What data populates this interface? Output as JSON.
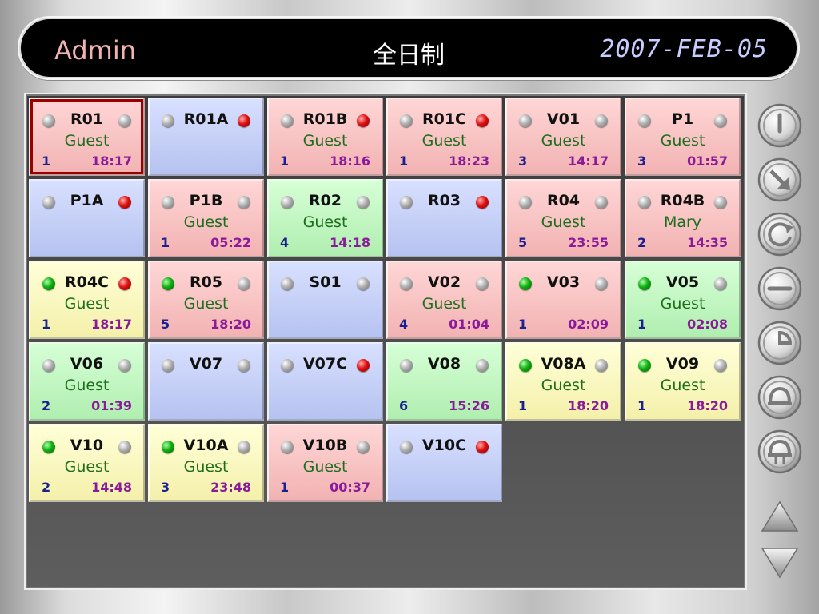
{
  "header": {
    "user": "Admin",
    "mode": "全日制",
    "date": "2007-FEB-05"
  },
  "colors": {
    "red": "#f2b2b2",
    "blue": "#b6c2f0",
    "green": "#b0eeb0",
    "yellow": "#f4f0aa"
  },
  "rooms": [
    {
      "name": "R01",
      "color": "red",
      "left": "gray",
      "right": "gray",
      "guest": "Guest",
      "count": "1",
      "time": "18:17",
      "selected": true
    },
    {
      "name": "R01A",
      "color": "blue",
      "left": "gray",
      "right": "red",
      "guest": "",
      "count": "",
      "time": ""
    },
    {
      "name": "R01B",
      "color": "red",
      "left": "gray",
      "right": "red",
      "guest": "Guest",
      "count": "1",
      "time": "18:16"
    },
    {
      "name": "R01C",
      "color": "red",
      "left": "gray",
      "right": "red",
      "guest": "Guest",
      "count": "1",
      "time": "18:23"
    },
    {
      "name": "V01",
      "color": "red",
      "left": "gray",
      "right": "gray",
      "guest": "Guest",
      "count": "3",
      "time": "14:17"
    },
    {
      "name": "P1",
      "color": "red",
      "left": "gray",
      "right": "gray",
      "guest": "Guest",
      "count": "3",
      "time": "01:57"
    },
    {
      "name": "P1A",
      "color": "blue",
      "left": "gray",
      "right": "red",
      "guest": "",
      "count": "",
      "time": ""
    },
    {
      "name": "P1B",
      "color": "red",
      "left": "gray",
      "right": "gray",
      "guest": "Guest",
      "count": "1",
      "time": "05:22"
    },
    {
      "name": "R02",
      "color": "green",
      "left": "gray",
      "right": "gray",
      "guest": "Guest",
      "count": "4",
      "time": "14:18"
    },
    {
      "name": "R03",
      "color": "blue",
      "left": "gray",
      "right": "red",
      "guest": "",
      "count": "",
      "time": ""
    },
    {
      "name": "R04",
      "color": "red",
      "left": "gray",
      "right": "gray",
      "guest": "Guest",
      "count": "5",
      "time": "23:55"
    },
    {
      "name": "R04B",
      "color": "red",
      "left": "gray",
      "right": "gray",
      "guest": "Mary",
      "count": "2",
      "time": "14:35"
    },
    {
      "name": "R04C",
      "color": "yellow",
      "left": "green",
      "right": "red",
      "guest": "Guest",
      "count": "1",
      "time": "18:17"
    },
    {
      "name": "R05",
      "color": "red",
      "left": "green",
      "right": "gray",
      "guest": "Guest",
      "count": "5",
      "time": "18:20"
    },
    {
      "name": "S01",
      "color": "blue",
      "left": "gray",
      "right": "gray",
      "guest": "",
      "count": "",
      "time": ""
    },
    {
      "name": "V02",
      "color": "red",
      "left": "gray",
      "right": "gray",
      "guest": "Guest",
      "count": "4",
      "time": "01:04"
    },
    {
      "name": "V03",
      "color": "red",
      "left": "green",
      "right": "gray",
      "guest": "",
      "count": "1",
      "time": "02:09"
    },
    {
      "name": "V05",
      "color": "green",
      "left": "green",
      "right": "gray",
      "guest": "Guest",
      "count": "1",
      "time": "02:08"
    },
    {
      "name": "V06",
      "color": "green",
      "left": "gray",
      "right": "gray",
      "guest": "Guest",
      "count": "2",
      "time": "01:39"
    },
    {
      "name": "V07",
      "color": "blue",
      "left": "gray",
      "right": "gray",
      "guest": "",
      "count": "",
      "time": ""
    },
    {
      "name": "V07C",
      "color": "blue",
      "left": "gray",
      "right": "red",
      "guest": "",
      "count": "",
      "time": ""
    },
    {
      "name": "V08",
      "color": "green",
      "left": "gray",
      "right": "gray",
      "guest": "",
      "count": "6",
      "time": "15:26"
    },
    {
      "name": "V08A",
      "color": "yellow",
      "left": "green",
      "right": "gray",
      "guest": "Guest",
      "count": "1",
      "time": "18:20"
    },
    {
      "name": "V09",
      "color": "yellow",
      "left": "green",
      "right": "gray",
      "guest": "Guest",
      "count": "1",
      "time": "18:20"
    },
    {
      "name": "V10",
      "color": "yellow",
      "left": "green",
      "right": "gray",
      "guest": "Guest",
      "count": "2",
      "time": "14:48"
    },
    {
      "name": "V10A",
      "color": "yellow",
      "left": "green",
      "right": "gray",
      "guest": "Guest",
      "count": "3",
      "time": "23:48"
    },
    {
      "name": "V10B",
      "color": "red",
      "left": "gray",
      "right": "gray",
      "guest": "Guest",
      "count": "1",
      "time": "00:37"
    },
    {
      "name": "V10C",
      "color": "blue",
      "left": "gray",
      "right": "red",
      "guest": "",
      "count": "",
      "time": ""
    }
  ],
  "side_buttons": [
    {
      "icon": "power-icon"
    },
    {
      "icon": "transfer-icon"
    },
    {
      "icon": "refresh-icon"
    },
    {
      "icon": "minus-icon"
    },
    {
      "icon": "clock-icon"
    },
    {
      "icon": "bell-icon"
    },
    {
      "icon": "alarm-bell-icon"
    }
  ],
  "nav": {
    "up": "scroll-up-icon",
    "down": "scroll-down-icon"
  }
}
